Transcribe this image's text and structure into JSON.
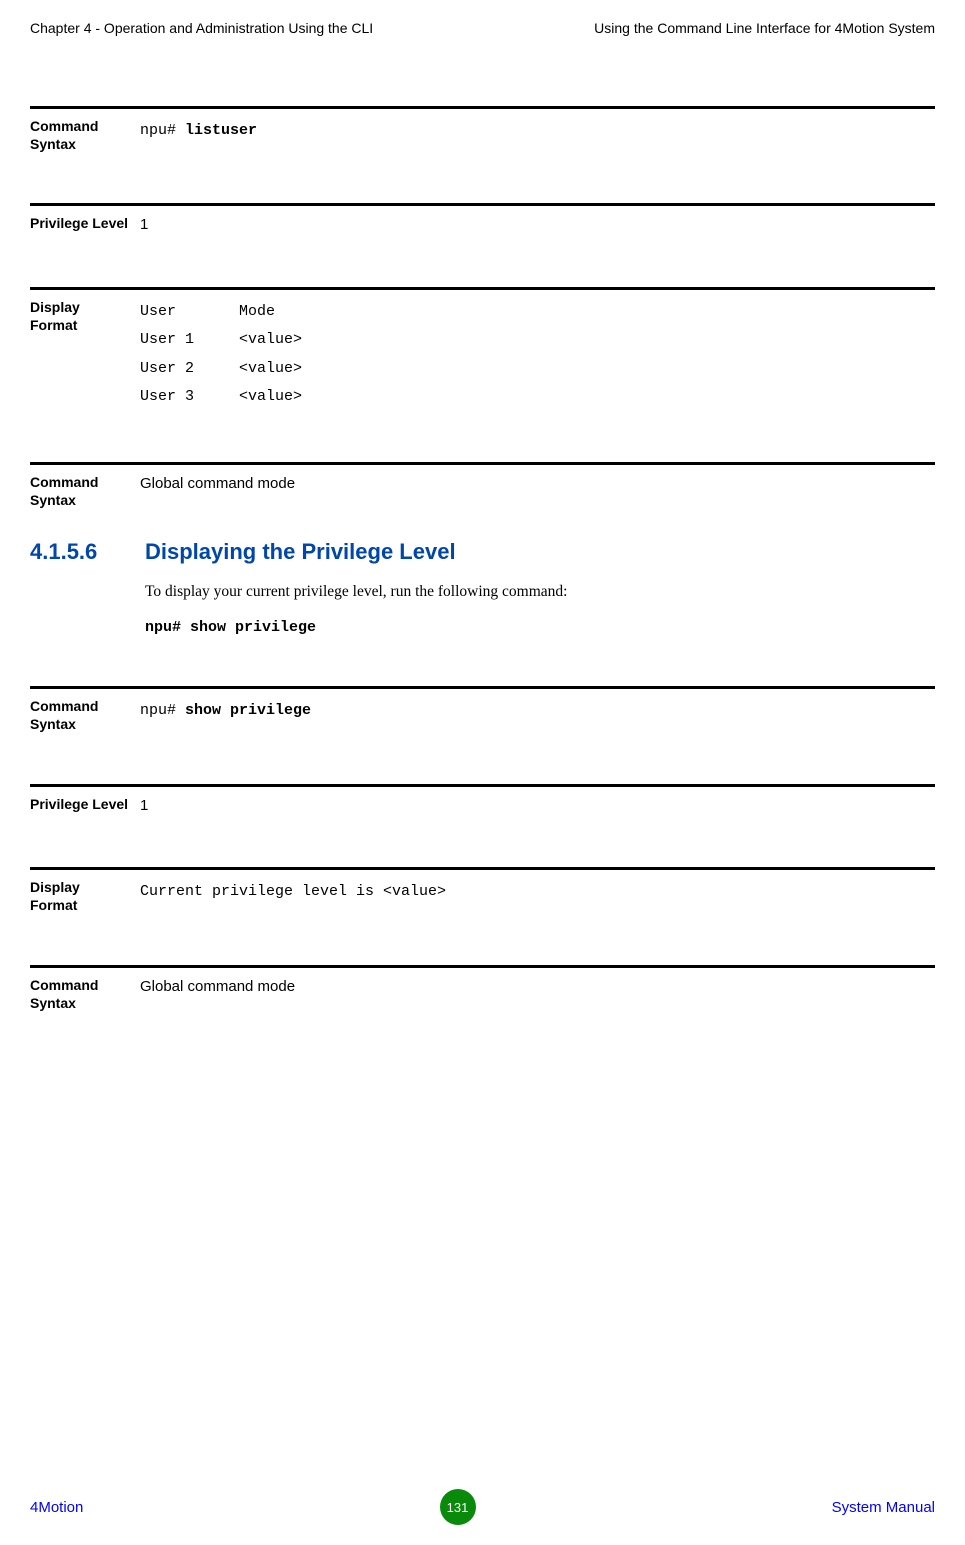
{
  "header": {
    "left": "Chapter 4 - Operation and Administration Using the CLI",
    "right": "Using the Command Line Interface for 4Motion System"
  },
  "block1": {
    "label": "Command Syntax",
    "prompt": "npu# ",
    "cmd": "listuser"
  },
  "block2": {
    "label": "Privilege Level",
    "value": "1"
  },
  "block3": {
    "label": "Display Format",
    "lines": "User       Mode\nUser 1     <value>\nUser 2     <value>\nUser 3     <value>"
  },
  "block4": {
    "label": "Command Syntax",
    "value": "Global command mode"
  },
  "section": {
    "number": "4.1.5.6",
    "title": "Displaying the Privilege Level",
    "body": "To display your current privilege level, run the following command:",
    "cmd": "npu# show privilege"
  },
  "block5": {
    "label": "Command Syntax",
    "prompt": "npu# ",
    "cmd": "show privilege"
  },
  "block6": {
    "label": "Privilege Level",
    "value": "1"
  },
  "block7": {
    "label": "Display Format",
    "value": "Current privilege level is <value>"
  },
  "block8": {
    "label": "Command Syntax",
    "value": "Global command mode"
  },
  "footer": {
    "left": "4Motion",
    "page": "131",
    "right": "System Manual"
  }
}
